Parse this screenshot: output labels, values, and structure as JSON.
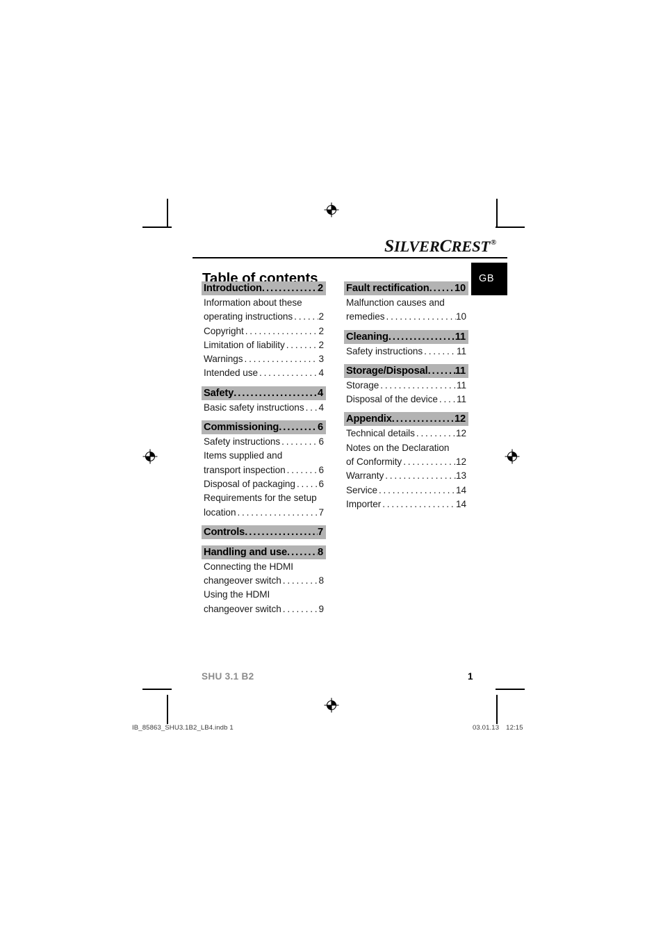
{
  "brand": {
    "name_part1": "S",
    "name_part2": "ILVER",
    "name_part3": "C",
    "name_part4": "REST",
    "registered_mark": "®"
  },
  "language_badge": "GB",
  "page_title": "Table of contents",
  "toc": {
    "left_column": [
      {
        "heading": "Introduction",
        "heading_page": "2",
        "entries": [
          {
            "lines": [
              "Information about these",
              "operating instructions"
            ],
            "page": "2"
          },
          {
            "lines": [
              "Copyright"
            ],
            "page": "2"
          },
          {
            "lines": [
              "Limitation of liability"
            ],
            "page": "2"
          },
          {
            "lines": [
              "Warnings"
            ],
            "page": "3"
          },
          {
            "lines": [
              "Intended use"
            ],
            "page": "4"
          }
        ]
      },
      {
        "heading": "Safety",
        "heading_page": "4",
        "entries": [
          {
            "lines": [
              "Basic safety instructions"
            ],
            "page": "4"
          }
        ]
      },
      {
        "heading": "Commissioning",
        "heading_page": "6",
        "entries": [
          {
            "lines": [
              "Safety instructions"
            ],
            "page": "6"
          },
          {
            "lines": [
              "Items supplied and",
              "transport inspection"
            ],
            "page": "6"
          },
          {
            "lines": [
              "Disposal of packaging"
            ],
            "page": "6"
          },
          {
            "lines": [
              "Requirements for the setup",
              "location"
            ],
            "page": "7"
          }
        ]
      },
      {
        "heading": "Controls",
        "heading_page": "7",
        "entries": []
      },
      {
        "heading": "Handling and use",
        "heading_page": "8",
        "entries": [
          {
            "lines": [
              "Connecting the HDMI",
              "changeover switch"
            ],
            "page": "8"
          },
          {
            "lines": [
              "Using the HDMI",
              "changeover switch"
            ],
            "page": "9"
          }
        ]
      }
    ],
    "right_column": [
      {
        "heading": "Fault rectification",
        "heading_page": "10",
        "entries": [
          {
            "lines": [
              "Malfunction causes and",
              "remedies"
            ],
            "page": "10"
          }
        ]
      },
      {
        "heading": "Cleaning",
        "heading_page": "11",
        "entries": [
          {
            "lines": [
              "Safety instructions"
            ],
            "page": "11"
          }
        ]
      },
      {
        "heading": "Storage/Disposal",
        "heading_page": "11",
        "entries": [
          {
            "lines": [
              "Storage"
            ],
            "page": "11"
          },
          {
            "lines": [
              "Disposal of the device"
            ],
            "page": "11"
          }
        ]
      },
      {
        "heading": "Appendix",
        "heading_page": "12",
        "entries": [
          {
            "lines": [
              "Technical details"
            ],
            "page": "12"
          },
          {
            "lines": [
              "Notes on the Declaration",
              "of Conformity"
            ],
            "page": "12"
          },
          {
            "lines": [
              "Warranty"
            ],
            "page": "13"
          },
          {
            "lines": [
              "Service"
            ],
            "page": "14"
          },
          {
            "lines": [
              "Importer"
            ],
            "page": "14"
          }
        ]
      }
    ]
  },
  "footer": {
    "model": "SHU 3.1 B2",
    "page_number": "1"
  },
  "imposition": {
    "file_name": "IB_85863_SHU3.1B2_LB4.indb   1",
    "date": "03.01.13",
    "time": "12:15"
  },
  "colors": {
    "heading_highlight": "#b3b3b3",
    "language_badge_bg": "#000000",
    "language_badge_fg": "#ffffff",
    "footer_model": "#8c8c8c",
    "text": "#1a1a1a"
  }
}
